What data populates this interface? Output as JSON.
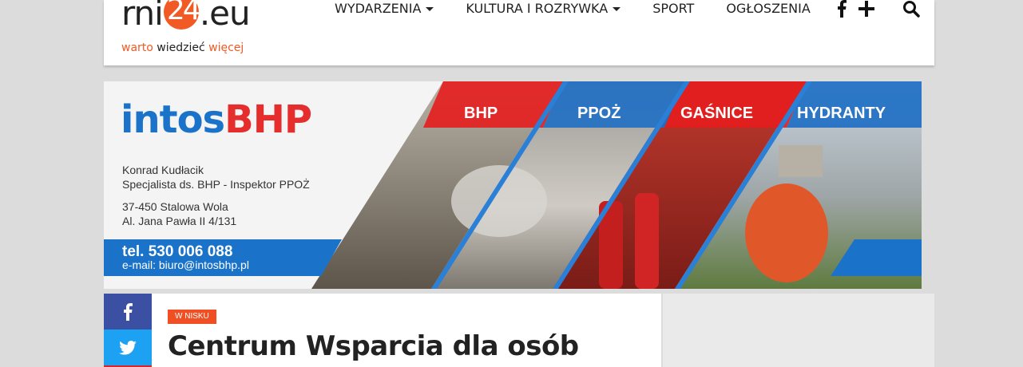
{
  "logo": {
    "pre": "rn",
    "i": "i",
    "number": "24",
    "suffix": ".eu",
    "tag_a": "warto",
    "tag_b": "wiedzieć",
    "tag_c": "więcej"
  },
  "nav": [
    {
      "label": "WYDARZENIA",
      "dropdown": true
    },
    {
      "label": "KULTURA I ROZRYWKA",
      "dropdown": true
    },
    {
      "label": "SPORT",
      "dropdown": false
    },
    {
      "label": "OGŁOSZENIA",
      "dropdown": false
    }
  ],
  "header_icons": [
    "facebook-icon",
    "plus-icon",
    "search-icon"
  ],
  "banner": {
    "brand_a": "intos",
    "brand_b": "BHP",
    "name": "Konrad Kudłacik",
    "role": "Specjalista ds. BHP - Inspektor PPOŻ",
    "postal": "37-450 Stalowa Wola",
    "street": "Al. Jana Pawła II 4/131",
    "tel": "tel. 530 006 088",
    "email": "e-mail: biuro@intosbhp.pl",
    "tabs": [
      "BHP",
      "PPOŻ",
      "GAŚNICE",
      "HYDRANTY"
    ]
  },
  "share": {
    "facebook": "facebook-icon",
    "twitter": "twitter-icon"
  },
  "article": {
    "category": "W NISKU",
    "title": "Centrum Wsparcia dla osób"
  },
  "colors": {
    "brand_orange": "#f15a24",
    "facebook": "#3b4fa3",
    "twitter": "#1da1f2",
    "banner_blue": "#1a73c9",
    "banner_red": "#e52d2d"
  }
}
